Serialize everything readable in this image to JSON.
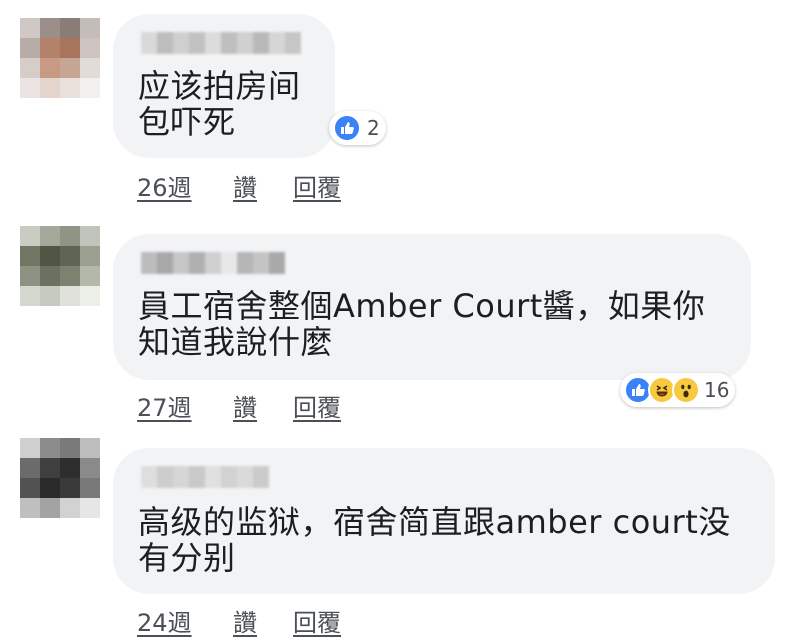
{
  "comments": [
    {
      "text": "应该拍房间\n包吓死",
      "time": "26週",
      "like_label": "讚",
      "reply_label": "回覆",
      "reactions": [
        "like-icon"
      ],
      "reaction_count": "2"
    },
    {
      "text": "員工宿舍整個Amber Court醬，如果你\n知道我說什麼",
      "time": "27週",
      "like_label": "讚",
      "reply_label": "回覆",
      "reactions": [
        "like-icon",
        "haha-icon",
        "wow-icon"
      ],
      "reaction_count": "16"
    },
    {
      "text": "高级的监狱，宿舍简直跟amber court没\n有分别",
      "time": "24週",
      "like_label": "讚",
      "reply_label": "回覆",
      "reactions": [],
      "reaction_count": ""
    }
  ],
  "colors": {
    "bubble": "#f2f3f5",
    "like_blue": "#3b82f6",
    "emoji_yellow": "#f7c93e",
    "meta_text": "#4b4f56"
  }
}
